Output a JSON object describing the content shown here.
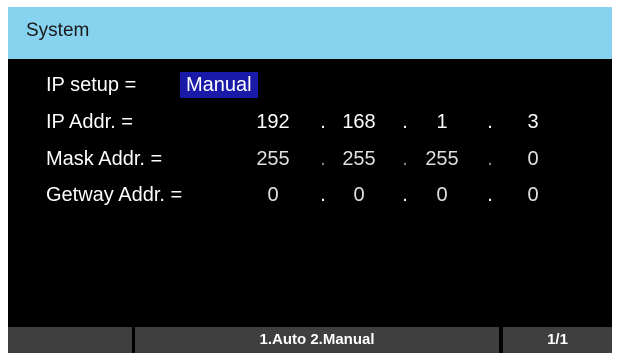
{
  "window": {
    "title": "System"
  },
  "ip_setup": {
    "label": "IP setup =",
    "value": "Manual"
  },
  "ip_addr": {
    "label": "IP Addr. =",
    "octets": [
      "192",
      "168",
      "1",
      "3"
    ]
  },
  "mask_addr": {
    "label": "Mask Addr. =",
    "octets": [
      "255",
      "255",
      "255",
      "0"
    ]
  },
  "getway_addr": {
    "label": "Getway Addr. =",
    "octets": [
      "0",
      "0",
      "0",
      "0"
    ]
  },
  "separator": ".",
  "softkeys": {
    "key1": "",
    "key2": "1.Auto 2.Manual",
    "key3": "1/1"
  },
  "colors": {
    "title_bar": "#87d3ef",
    "selection": "#1a1aa8",
    "softkey": "#3f3f3f",
    "screen_background": "#000000"
  }
}
